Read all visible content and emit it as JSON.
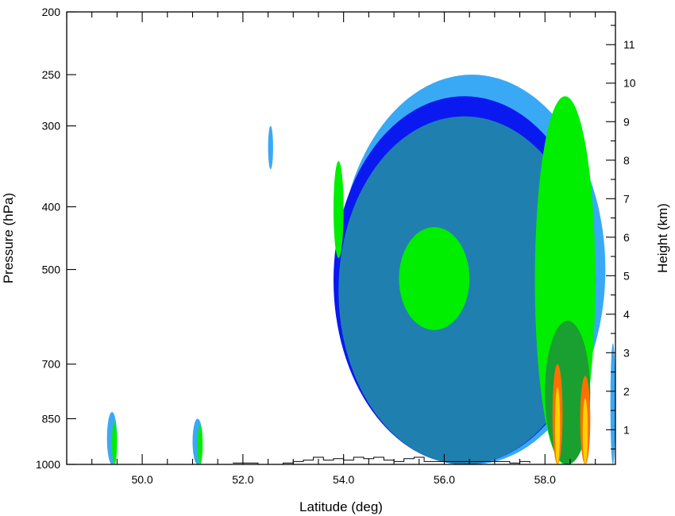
{
  "chart_data": {
    "type": "heatmap",
    "xlabel": "Latitude (deg)",
    "ylabel": "Pressure (hPa)",
    "y2label": "Height (km)",
    "xlim": [
      48.5,
      59.4
    ],
    "ylim": [
      1000,
      200
    ],
    "y_scale": "log",
    "x_ticks": [
      "50.0",
      "52.0",
      "54.0",
      "56.0",
      "58.0"
    ],
    "y_ticks": [
      "200",
      "250",
      "300",
      "400",
      "500",
      "700",
      "850",
      "1000"
    ],
    "y2_ticks": [
      "1",
      "2",
      "3",
      "4",
      "5",
      "6",
      "7",
      "8",
      "9",
      "10",
      "11"
    ],
    "colors": [
      "#39a9f5",
      "#0a19f0",
      "#1f80b0",
      "#00ee00",
      "#1aa030",
      "#ff7000",
      "#ffd000"
    ],
    "series": [
      {
        "level": 1,
        "color": "#39a9f5",
        "regions": [
          {
            "lat": [
              53.9,
              59.2
            ],
            "p": [
              250,
              1000
            ]
          },
          {
            "lat": [
              49.3,
              49.5
            ],
            "p": [
              830,
              1000
            ]
          },
          {
            "lat": [
              51.0,
              51.2
            ],
            "p": [
              850,
              1000
            ]
          },
          {
            "lat": [
              52.5,
              52.6
            ],
            "p": [
              300,
              350
            ]
          },
          {
            "lat": [
              59.3,
              59.4
            ],
            "p": [
              650,
              1000
            ]
          }
        ]
      },
      {
        "level": 2,
        "color": "#0a19f0",
        "regions": [
          {
            "lat": [
              53.8,
              59.0
            ],
            "p": [
              270,
              1000
            ]
          }
        ]
      },
      {
        "level": 3,
        "color": "#1f80b0",
        "regions": [
          {
            "lat": [
              53.9,
              58.9
            ],
            "p": [
              290,
              1000
            ]
          }
        ]
      },
      {
        "level": 4,
        "color": "#00ee00",
        "regions": [
          {
            "lat": [
              53.8,
              54.0
            ],
            "p": [
              340,
              480
            ]
          },
          {
            "lat": [
              55.1,
              56.5
            ],
            "p": [
              430,
              620
            ]
          },
          {
            "lat": [
              57.8,
              59.0
            ],
            "p": [
              270,
              1000
            ]
          },
          {
            "lat": [
              49.4,
              49.5
            ],
            "p": [
              860,
              1000
            ]
          },
          {
            "lat": [
              51.1,
              51.2
            ],
            "p": [
              870,
              1000
            ]
          }
        ]
      },
      {
        "level": 5,
        "color": "#1aa030",
        "regions": [
          {
            "lat": [
              58.0,
              58.9
            ],
            "p": [
              600,
              1000
            ]
          }
        ]
      },
      {
        "level": 6,
        "color": "#ff7000",
        "regions": [
          {
            "lat": [
              58.15,
              58.35
            ],
            "p": [
              700,
              1000
            ]
          },
          {
            "lat": [
              58.7,
              58.9
            ],
            "p": [
              730,
              1000
            ]
          }
        ]
      },
      {
        "level": 7,
        "color": "#ffd000",
        "regions": [
          {
            "lat": [
              58.2,
              58.3
            ],
            "p": [
              760,
              1000
            ]
          },
          {
            "lat": [
              58.75,
              58.85
            ],
            "p": [
              790,
              1000
            ]
          }
        ]
      }
    ],
    "terrain_outline": {
      "lat": [
        51.8,
        52.0,
        52.3,
        52.8,
        53.0,
        53.2,
        53.4,
        53.6,
        53.8,
        54.0,
        54.2,
        54.4,
        54.6,
        54.8,
        55.0,
        55.2,
        55.4,
        55.6,
        57.3,
        57.5,
        57.7
      ],
      "p": [
        995,
        995,
        1000,
        995,
        990,
        985,
        975,
        985,
        980,
        985,
        975,
        980,
        975,
        985,
        990,
        980,
        975,
        990,
        995,
        990,
        995
      ]
    }
  }
}
